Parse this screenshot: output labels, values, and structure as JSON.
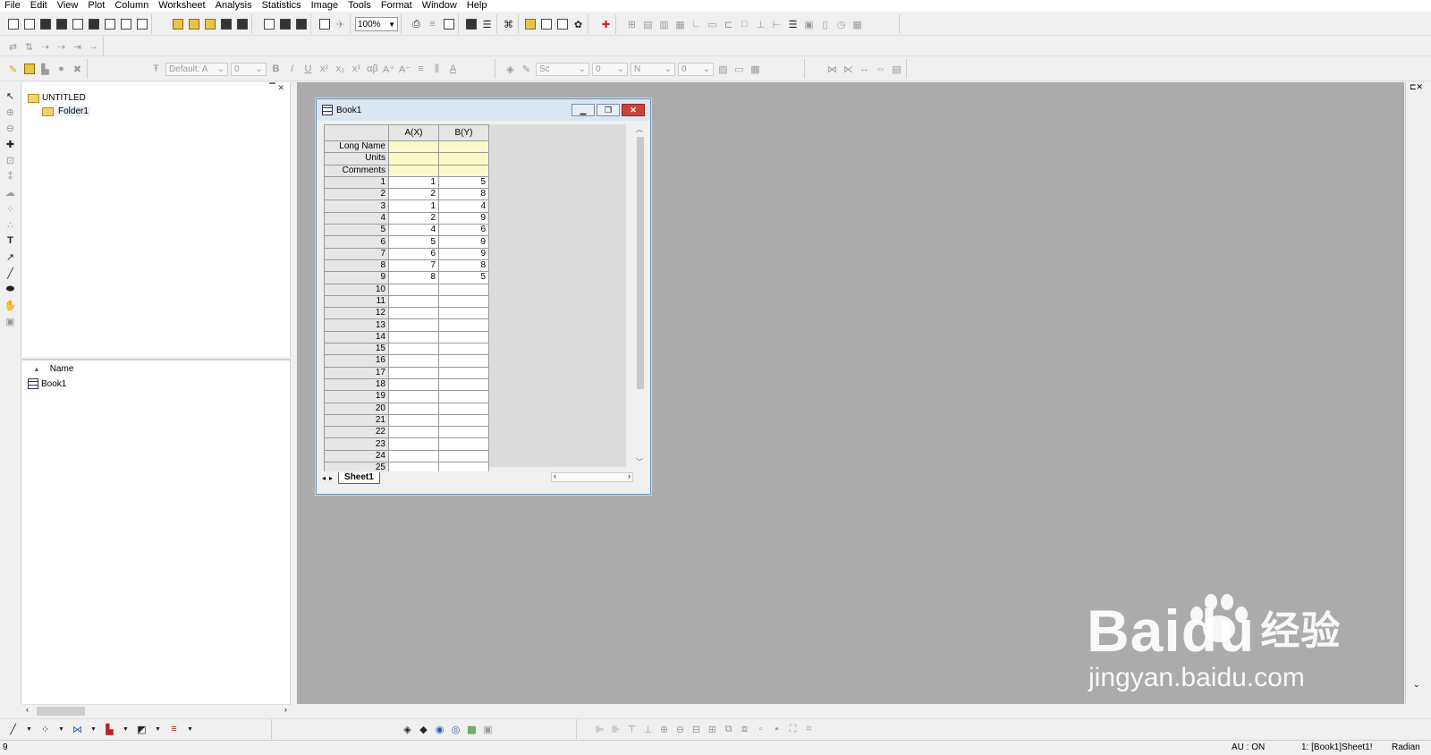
{
  "menu": [
    "File",
    "Edit",
    "View",
    "Plot",
    "Column",
    "Worksheet",
    "Analysis",
    "Statistics",
    "Image",
    "Tools",
    "Format",
    "Window",
    "Help"
  ],
  "toolbar": {
    "zoom": "100%",
    "font_name": "Default: A",
    "font_size": "0",
    "line_style": "Sc",
    "line_width": "0",
    "box_label": "N",
    "box_num": "0"
  },
  "project_explorer": {
    "root": "UNTITLED",
    "folder": "Folder1",
    "name_header": "Name",
    "item": "Book1"
  },
  "book": {
    "title": "Book1",
    "columns": [
      "A(X)",
      "B(Y)"
    ],
    "meta_rows": [
      "Long Name",
      "Units",
      "Comments"
    ],
    "rows": [
      [
        "1",
        "1",
        "5"
      ],
      [
        "2",
        "2",
        "8"
      ],
      [
        "3",
        "1",
        "4"
      ],
      [
        "4",
        "2",
        "9"
      ],
      [
        "5",
        "4",
        "6"
      ],
      [
        "6",
        "5",
        "9"
      ],
      [
        "7",
        "6",
        "9"
      ],
      [
        "8",
        "7",
        "8"
      ],
      [
        "9",
        "8",
        "5"
      ],
      [
        "10",
        "",
        ""
      ],
      [
        "11",
        "",
        ""
      ],
      [
        "12",
        "",
        ""
      ],
      [
        "13",
        "",
        ""
      ],
      [
        "14",
        "",
        ""
      ],
      [
        "15",
        "",
        ""
      ],
      [
        "16",
        "",
        ""
      ],
      [
        "17",
        "",
        ""
      ],
      [
        "18",
        "",
        ""
      ],
      [
        "19",
        "",
        ""
      ],
      [
        "20",
        "",
        ""
      ],
      [
        "21",
        "",
        ""
      ],
      [
        "22",
        "",
        ""
      ],
      [
        "23",
        "",
        ""
      ],
      [
        "24",
        "",
        ""
      ],
      [
        "25",
        "",
        ""
      ]
    ],
    "sheet_tab": "Sheet1"
  },
  "status": {
    "left": "9",
    "au": "AU : ON",
    "window": "1: [Book1]Sheet1!",
    "angle": "Radian"
  },
  "watermark": {
    "main": "Baidu",
    "cn": "经验",
    "sub": "jingyan.baidu.com"
  },
  "colors": {
    "mdi_bg": "#ababab",
    "meta_row": "#fcf9c8",
    "close_btn": "#c8443a"
  }
}
